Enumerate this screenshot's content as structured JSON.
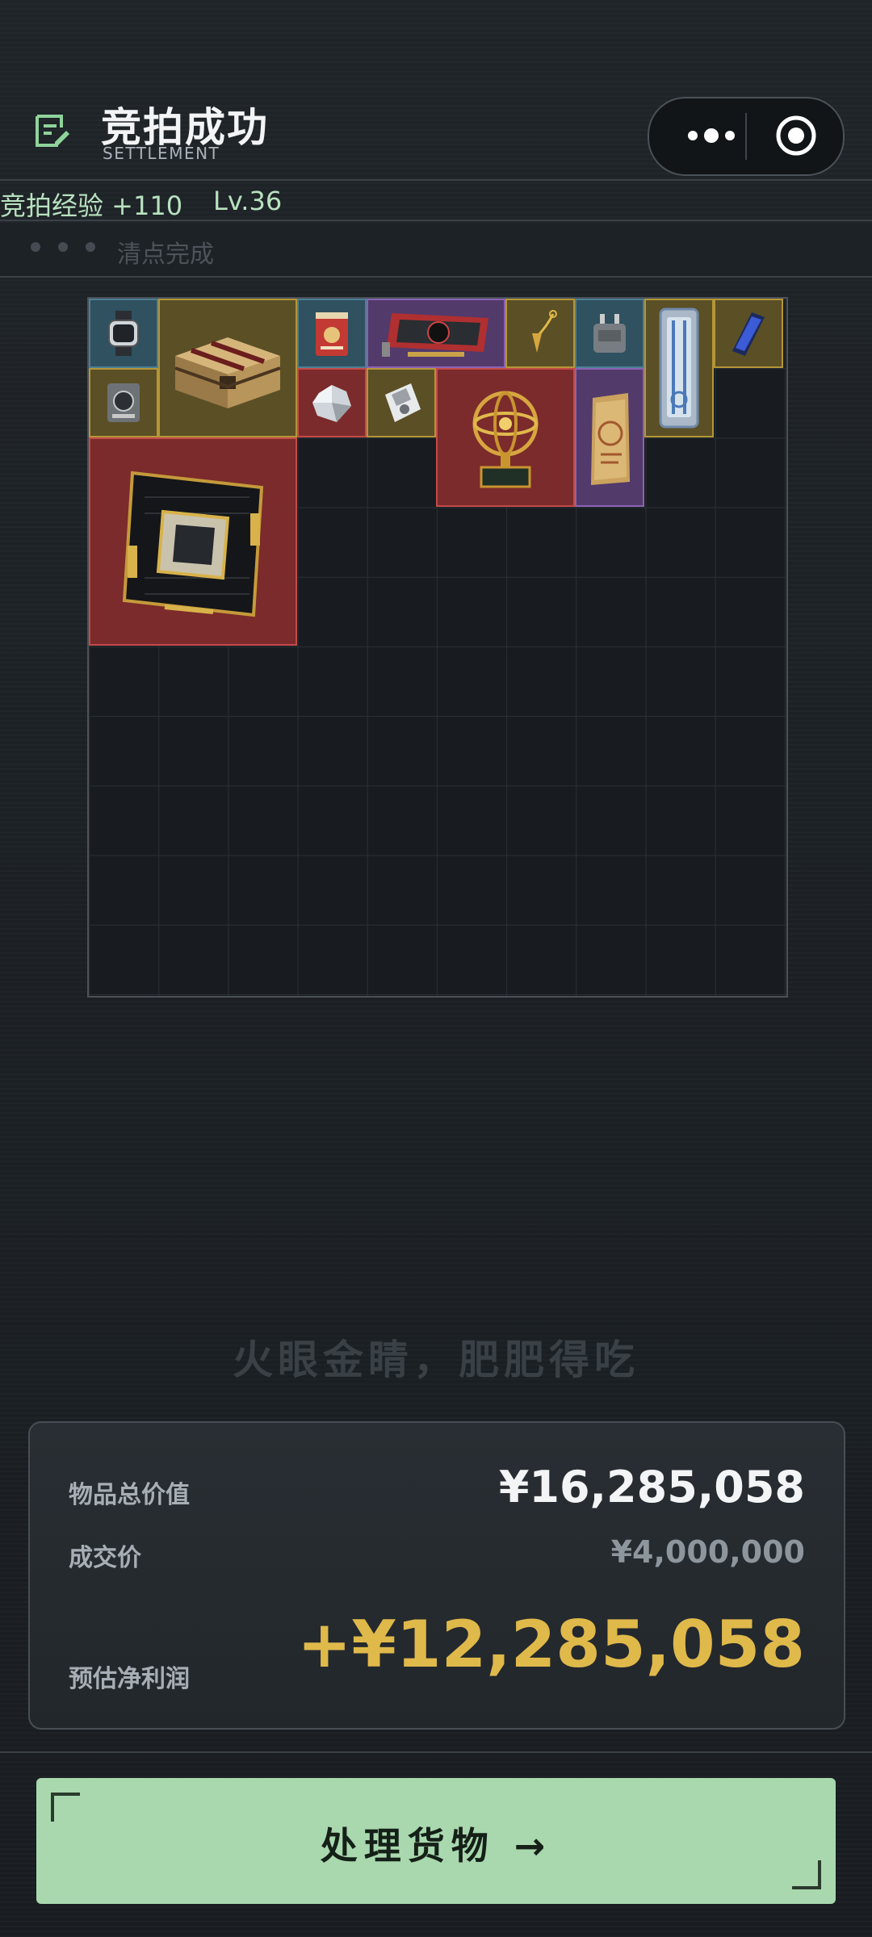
{
  "header": {
    "title": "竞拍成功",
    "subtitle": "SETTLEMENT",
    "menu_icon": "more-dots-icon",
    "close_icon": "target-close-icon"
  },
  "progress": {
    "experience": "竞拍经验 +110",
    "level": "Lv.36",
    "status": "清点完成"
  },
  "inventory": {
    "items": [
      {
        "name": "watch",
        "rarity": "blue",
        "icon": "watch-icon"
      },
      {
        "name": "supply-crate",
        "rarity": "gold",
        "icon": "crate-icon"
      },
      {
        "name": "red-tin",
        "rarity": "blue",
        "icon": "tin-icon"
      },
      {
        "name": "graphics-card",
        "rarity": "purple",
        "icon": "gpu-icon"
      },
      {
        "name": "pendulum",
        "rarity": "gold",
        "icon": "pendulum-icon"
      },
      {
        "name": "power-adapter",
        "rarity": "blue",
        "icon": "adapter-icon"
      },
      {
        "name": "tool-case",
        "rarity": "gold",
        "icon": "toolcase-icon"
      },
      {
        "name": "smartphone",
        "rarity": "gold",
        "icon": "phone-icon"
      },
      {
        "name": "meter-device",
        "rarity": "gold",
        "icon": "meter-icon"
      },
      {
        "name": "diamond",
        "rarity": "red",
        "icon": "diamond-icon"
      },
      {
        "name": "floppy-disk",
        "rarity": "gold",
        "icon": "floppy-icon"
      },
      {
        "name": "armillary-sphere",
        "rarity": "red",
        "icon": "armillary-icon"
      },
      {
        "name": "document-folder",
        "rarity": "purple",
        "icon": "folder-icon"
      },
      {
        "name": "processor-chip",
        "rarity": "red",
        "icon": "cpu-icon"
      }
    ]
  },
  "slogan": "火眼金睛，肥肥得吃",
  "summary": {
    "total_label": "物品总价值",
    "total_value": "¥16,285,058",
    "deal_label": "成交价",
    "deal_value": "¥4,000,000",
    "profit_label": "预估净利润",
    "profit_value": "+¥12,285,058"
  },
  "action": {
    "label": "处理货物 →"
  },
  "colors": {
    "accent_green": "#a9d8ae",
    "profit_gold": "#e0b94b",
    "rarity_gold": "#b49636",
    "rarity_red": "#c44a48",
    "rarity_blue": "#4d7f95",
    "rarity_purple": "#8a63b3"
  }
}
